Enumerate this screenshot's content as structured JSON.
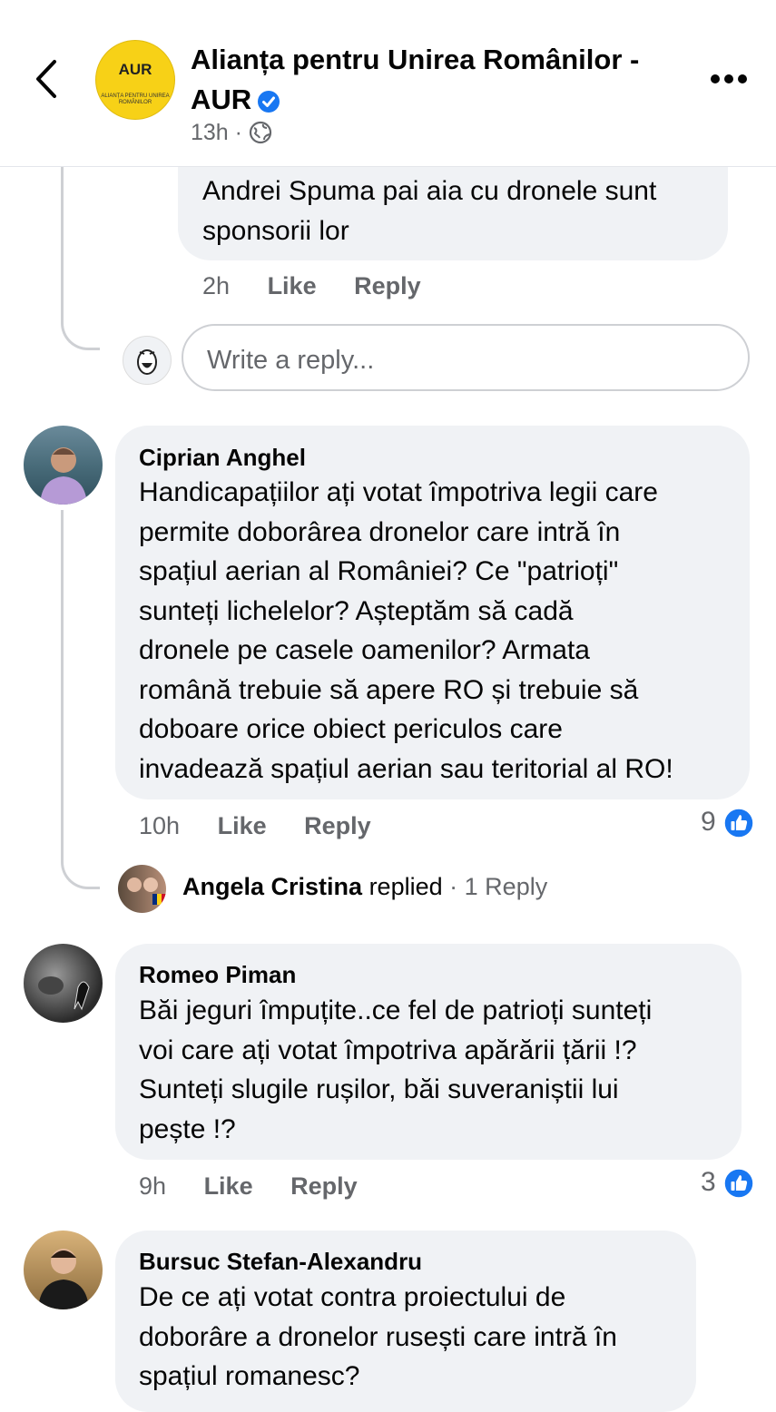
{
  "header": {
    "page_name": "Alianța pentru Unirea Românilor - AUR",
    "logo_text": "AUR",
    "logo_subtext": "ALIANȚA PENTRU UNIREA ROMÂNILOR",
    "time": "13h",
    "separator": "·",
    "icons": {
      "back": "chevron-left-icon",
      "verified": "verified-badge-icon",
      "audience": "globe-icon",
      "more": "more-horizontal-icon"
    },
    "accent_color": "#1877f2"
  },
  "reply_box": {
    "text_line1": "Andrei Spuma pai aia cu dronele sunt",
    "text_line2": "sponsorii lor",
    "time": "2h",
    "like": "Like",
    "reply": "Reply"
  },
  "write_reply": {
    "placeholder": "Write a reply..."
  },
  "comments": [
    {
      "name": "Ciprian Anghel",
      "lines": [
        "Handicapațiilor ați votat împotriva legii care",
        "permite doborârea dronelor care intră în",
        "spațiul aerian al României? Ce \"patrioți\"",
        "sunteți lichelelor? Așteptăm să cadă",
        "dronele pe casele oamenilor? Armata",
        "română trebuie să apere RO și trebuie să",
        "doboare orice obiect periculos care",
        "invadează spațiul aerian sau teritorial al RO!"
      ],
      "time": "10h",
      "like": "Like",
      "reply": "Reply",
      "reactions": "9",
      "replied_name": "Angela Cristina",
      "replied_label": "replied",
      "replied_sep": "·",
      "replied_count": "1 Reply"
    },
    {
      "name": "Romeo Piman",
      "lines": [
        "Băi jeguri împuțite..ce fel de patrioți sunteți",
        "voi care ați votat împotriva apărării țării  !?",
        "Sunteți slugile rușilor, băi suveraniștii lui",
        "pește  !?"
      ],
      "time": "9h",
      "like": "Like",
      "reply": "Reply",
      "reactions": "3"
    },
    {
      "name": "Bursuc Stefan-Alexandru",
      "lines": [
        "De ce ați votat contra proiectului de",
        "doborâre a dronelor rusești care intră în",
        "spațiul romanesc?"
      ]
    }
  ]
}
